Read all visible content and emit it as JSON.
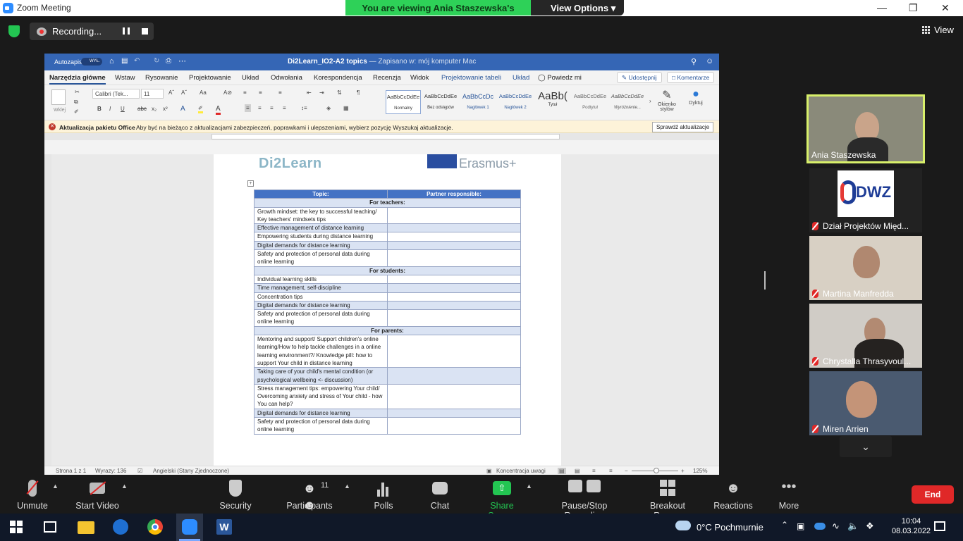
{
  "window": {
    "title": "Zoom Meeting"
  },
  "banner": {
    "viewing": "You are viewing Ania Staszewska's screen",
    "view_options": "View Options"
  },
  "recording": {
    "label": "Recording..."
  },
  "view_label": "View",
  "word": {
    "autosave": "Autozapis",
    "autosave_state": "WYŁ.",
    "doc_title": "Di2Learn_IO2-A2 topics",
    "doc_saved": "— Zapisano w: mój komputer Mac",
    "menu": [
      "Narzędzia główne",
      "Wstaw",
      "Rysowanie",
      "Projektowanie",
      "Układ",
      "Odwołania",
      "Korespondencja",
      "Recenzja",
      "Widok",
      "Projektowanie tabeli",
      "Układ",
      "Powiedz mi"
    ],
    "share": "Udostępnij",
    "comments": "Komentarze",
    "font_name": "Calibri (Tek...",
    "font_size": "11",
    "paste_label": "Wklej",
    "styles": [
      {
        "preview": "AaBbCcDdEe",
        "name": "Normalny"
      },
      {
        "preview": "AaBbCcDdEe",
        "name": "Bez odstępów"
      },
      {
        "preview": "AaBbCcDc",
        "name": "Nagłówek 1"
      },
      {
        "preview": "AaBbCcDdEe",
        "name": "Nagłówek 2"
      },
      {
        "preview": "AaBb(",
        "name": "Tytuł"
      },
      {
        "preview": "AaBbCcDdEe",
        "name": "Podtytuł"
      },
      {
        "preview": "AaBbCcDdEe",
        "name": "Wyróżnienie..."
      }
    ],
    "styles_pane": "Okienko stylów",
    "dictate": "Dyktuj",
    "info_title": "Aktualizacja pakietu Office",
    "info_msg": "Aby być na bieżąco z aktualizacjami zabezpieczeń, poprawkami i ulepszeniami, wybierz pozycję Wyszukaj aktualizacje.",
    "info_btn": "Sprawdź aktualizacje",
    "logo_left": "Di2Learn",
    "logo_right": "Erasmus+",
    "table": {
      "headers": [
        "Topic:",
        "Partner responsible:"
      ],
      "rows": [
        {
          "type": "section",
          "text": "For teachers:"
        },
        {
          "type": "row",
          "text": "Growth mindset: the key to successful teaching/ Key teachers' mindsets tips",
          "alt": false
        },
        {
          "type": "row",
          "text": "Effective management of distance learning",
          "alt": true
        },
        {
          "type": "row",
          "text": "Empowering students during distance learning",
          "alt": false
        },
        {
          "type": "row",
          "text": "Digital demands for distance learning",
          "alt": true
        },
        {
          "type": "row",
          "text": "Safety and protection of personal data during online learning",
          "alt": false
        },
        {
          "type": "section",
          "text": "For students:"
        },
        {
          "type": "row",
          "text": "Individual learning skills",
          "alt": false
        },
        {
          "type": "row",
          "text": "Time management, self-discipline",
          "alt": true
        },
        {
          "type": "row",
          "text": "Concentration tips",
          "alt": false
        },
        {
          "type": "row",
          "text": "Digital demands for distance learning",
          "alt": true
        },
        {
          "type": "row",
          "text": "Safety and protection of personal data during online learning",
          "alt": false
        },
        {
          "type": "section",
          "text": "For parents:"
        },
        {
          "type": "row",
          "text": "Mentoring and support/ Support children's online learning/How to help tackle challenges in a online learning environment?/ Knowledge pill: how to support Your child in distance learning",
          "alt": false
        },
        {
          "type": "row",
          "text": "Taking care of your child's mental condition (or psychological wellbeing <- discussion)",
          "alt": true
        },
        {
          "type": "row",
          "text": "Stress management tips: empowering Your child/ Overcoming anxiety and stress of Your child - how You can help?",
          "alt": false
        },
        {
          "type": "row",
          "text": "Digital demands for distance learning",
          "alt": true
        },
        {
          "type": "row",
          "text": "Safety and protection of personal data during online learning",
          "alt": false
        }
      ]
    },
    "status": {
      "page": "Strona 1 z 1",
      "words": "Wyrazy: 136",
      "lang": "Angielski (Stany Zjednoczone)",
      "focus": "Koncentracja uwagi",
      "zoom": "125%"
    }
  },
  "participants": [
    {
      "name": "Ania Staszewska",
      "muted": false,
      "active": true
    },
    {
      "name": "Dział Projektów Międ...",
      "muted": true,
      "logo": "DWZ"
    },
    {
      "name": "Martina Manfredda",
      "muted": true
    },
    {
      "name": "Chrystalla Thrasyvoul...",
      "muted": true
    },
    {
      "name": "Miren Arrien",
      "muted": true
    }
  ],
  "toolbar": {
    "unmute": "Unmute",
    "start_video": "Start Video",
    "security": "Security",
    "participants": "Participants",
    "participants_count": "11",
    "polls": "Polls",
    "chat": "Chat",
    "share": "Share Screen",
    "pause_rec": "Pause/Stop Recording",
    "breakout": "Breakout Rooms",
    "reactions": "Reactions",
    "more": "More",
    "end": "End"
  },
  "taskbar": {
    "weather": "0°C Pochmurnie",
    "time": "10:04",
    "date": "08.03.2022"
  },
  "colors": {
    "zoom_blue": "#2d8cff",
    "green": "#2ed158",
    "end_red": "#e02828",
    "word_blue": "#3566b5"
  }
}
